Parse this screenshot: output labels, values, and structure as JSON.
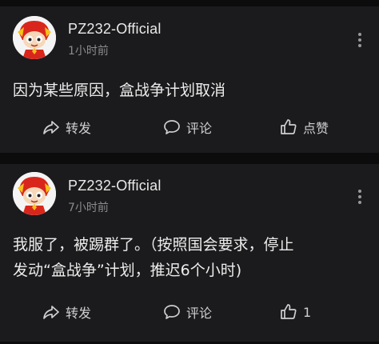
{
  "colors": {
    "background": "#0c0c0d",
    "card": "#1b1b1d",
    "text": "#ececec",
    "muted": "#8b8b8f",
    "avatar_red": "#d9261c",
    "avatar_gold": "#f3c21b"
  },
  "posts": [
    {
      "author": "PZ232-Official",
      "time": "1小时前",
      "text": "因为某些原因，盒战争计划取消",
      "actions": {
        "repost": "转发",
        "comment": "评论",
        "like": "点赞"
      },
      "icons": [
        "avatar",
        "more-icon",
        "share-icon",
        "comment-icon",
        "thumbs-up-icon"
      ]
    },
    {
      "author": "PZ232-Official",
      "time": "7小时前",
      "text_line1": "我服了，被踢群了。（按照国会要求，停止",
      "text_line2": "发动“盒战争”计划，推迟6个小时)",
      "actions": {
        "repost": "转发",
        "comment": "评论",
        "like": "1"
      },
      "icons": [
        "avatar",
        "more-icon",
        "share-icon",
        "comment-icon",
        "thumbs-up-icon"
      ]
    }
  ]
}
